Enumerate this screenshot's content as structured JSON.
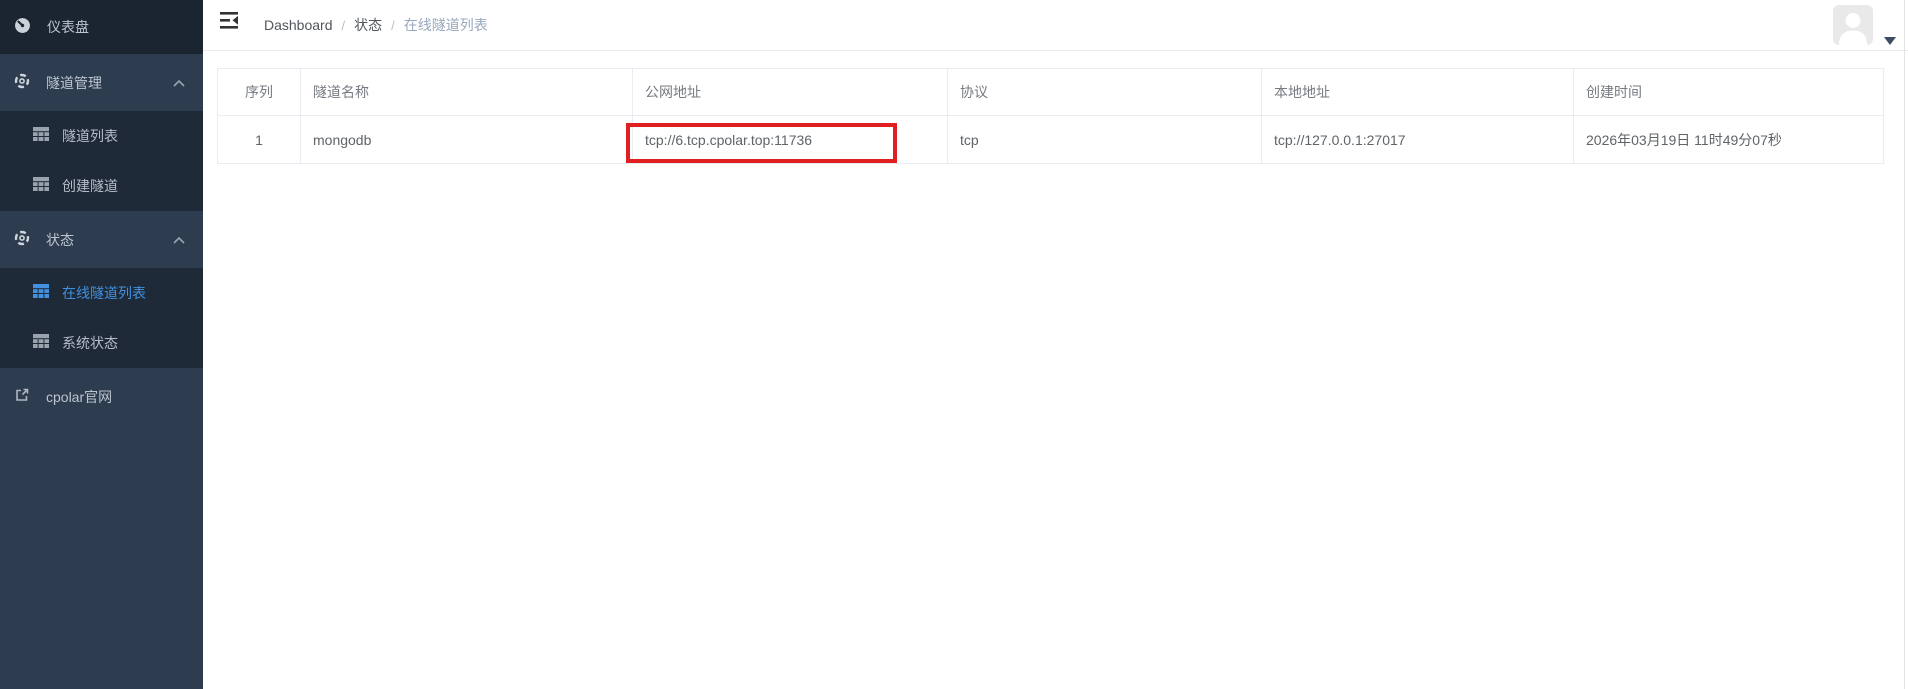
{
  "app": {
    "accent_blue": "#4191e0",
    "highlight_red": "#e02020",
    "sidebar_bg": "#2e3c50",
    "sidebar_submenu_bg": "#1f2a38",
    "sidebar_top_bg": "#1b2531"
  },
  "sidebar": {
    "items": [
      {
        "label": "仪表盘",
        "icon": "gauge-icon"
      },
      {
        "label": "隧道管理",
        "icon": "ring-icon",
        "expanded": true
      },
      {
        "label": "隧道列表",
        "icon": "table-grid-icon"
      },
      {
        "label": "创建隧道",
        "icon": "table-grid-icon"
      },
      {
        "label": "状态",
        "icon": "ring-icon",
        "expanded": true
      },
      {
        "label": "在线隧道列表",
        "icon": "table-grid-icon",
        "active": true
      },
      {
        "label": "系统状态",
        "icon": "table-grid-icon"
      },
      {
        "label": "cpolar官网",
        "icon": "external-link-icon"
      }
    ]
  },
  "breadcrumb": {
    "items": [
      "Dashboard",
      "状态",
      "在线隧道列表"
    ],
    "separator": "/"
  },
  "table": {
    "columns": [
      "序列",
      "隧道名称",
      "公网地址",
      "协议",
      "本地地址",
      "创建时间"
    ],
    "rows": [
      {
        "seq": "1",
        "name": "mongodb",
        "public_url": "tcp://6.tcp.cpolar.top:11736",
        "protocol": "tcp",
        "local_addr": "tcp://127.0.0.1:27017",
        "created_at": "2026年03月19日 11时49分07秒"
      }
    ]
  }
}
